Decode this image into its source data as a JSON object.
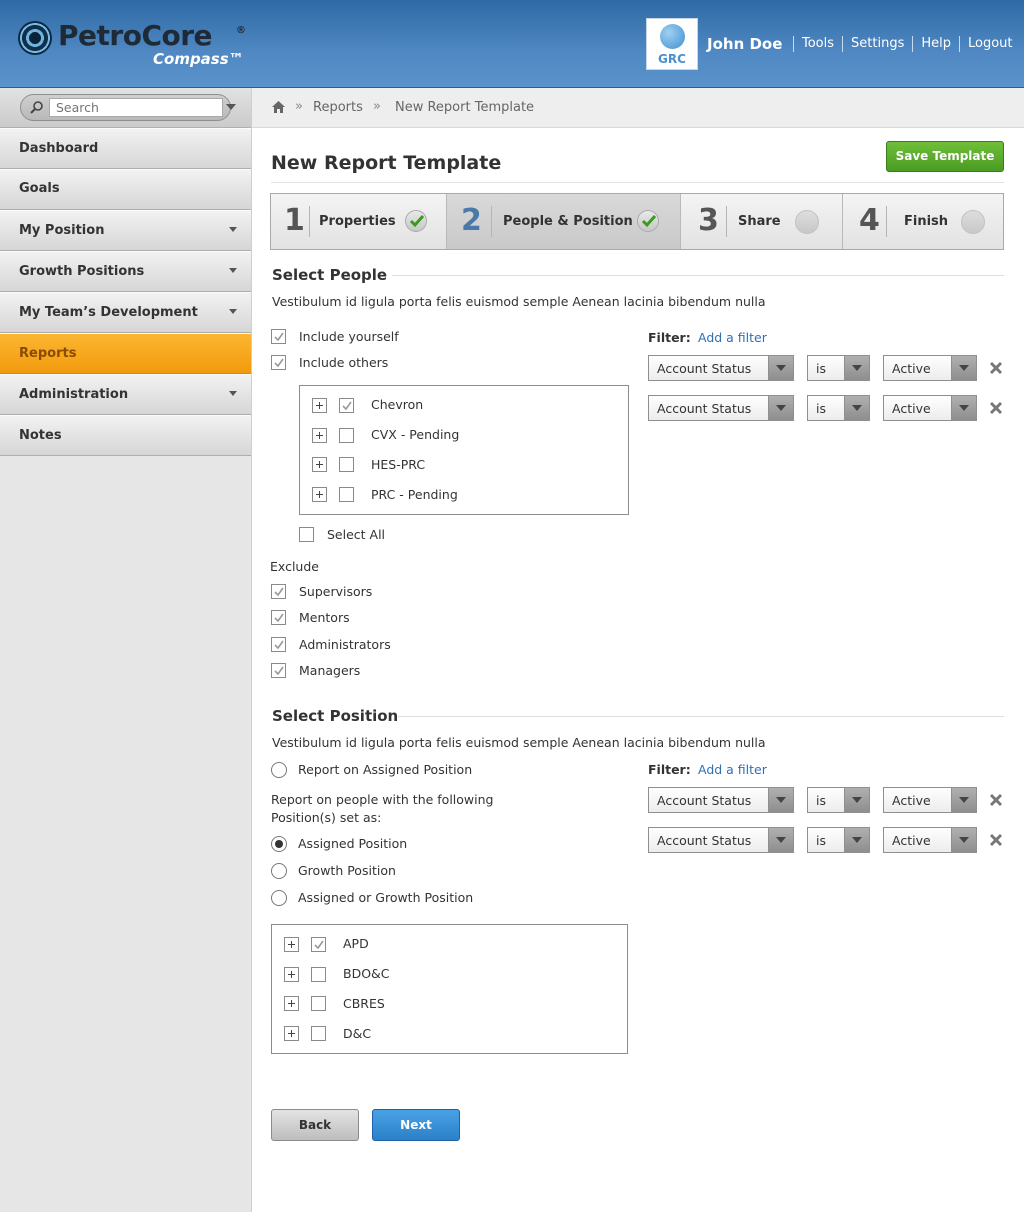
{
  "header": {
    "logo_name": "PetroCore",
    "logo_reg": "®",
    "logo_sub": "Compass™",
    "grc_badge": "GRC",
    "user_name": "John Doe",
    "links": [
      "Tools",
      "Settings",
      "Help",
      "Logout"
    ]
  },
  "sidebar": {
    "search_placeholder": "Search",
    "items": [
      {
        "label": "Dashboard",
        "has_arrow": false,
        "active": false
      },
      {
        "label": "Goals",
        "has_arrow": false,
        "active": false
      },
      {
        "label": "My Position",
        "has_arrow": true,
        "active": false
      },
      {
        "label": "Growth Positions",
        "has_arrow": true,
        "active": false
      },
      {
        "label": "My Team’s Development",
        "has_arrow": true,
        "active": false
      },
      {
        "label": "Reports",
        "has_arrow": false,
        "active": true
      },
      {
        "label": "Administration",
        "has_arrow": true,
        "active": false
      },
      {
        "label": "Notes",
        "has_arrow": false,
        "active": false
      }
    ]
  },
  "breadcrumb": {
    "items": [
      "Reports",
      "New Report Template"
    ],
    "separator": "»"
  },
  "page": {
    "title": "New Report Template",
    "save_label": "Save Template"
  },
  "steps": [
    {
      "num": "1",
      "label": "Properties",
      "status": "complete"
    },
    {
      "num": "2",
      "label": "People & Position",
      "status": "complete"
    },
    {
      "num": "3",
      "label": "Share",
      "status": "pending"
    },
    {
      "num": "4",
      "label": "Finish",
      "status": "pending"
    }
  ],
  "select_people": {
    "title": "Select People",
    "description": "Vestibulum id ligula porta felis euismod semple Aenean lacinia bibendum nulla",
    "include_yourself": {
      "label": "Include yourself",
      "checked": true
    },
    "include_others": {
      "label": "Include others",
      "checked": true
    },
    "tree": [
      {
        "label": "Chevron",
        "checked": true
      },
      {
        "label": "CVX - Pending",
        "checked": false
      },
      {
        "label": "HES-PRC",
        "checked": false
      },
      {
        "label": "PRC - Pending",
        "checked": false
      }
    ],
    "select_all": {
      "label": "Select All",
      "checked": false
    },
    "exclude_label": "Exclude",
    "exclude": [
      {
        "label": "Supervisors",
        "checked": true
      },
      {
        "label": "Mentors",
        "checked": true
      },
      {
        "label": "Administrators",
        "checked": true
      },
      {
        "label": "Managers",
        "checked": true
      }
    ],
    "filter_label": "Filter:",
    "add_filter": "Add a filter",
    "filters": [
      {
        "field": "Account Status",
        "op": "is",
        "value": "Active"
      },
      {
        "field": "Account Status",
        "op": "is",
        "value": "Active"
      }
    ]
  },
  "select_position": {
    "title": "Select Position",
    "description": "Vestibulum id ligula porta felis euismod semple Aenean lacinia bibendum nulla",
    "report_assigned": {
      "label": "Report on Assigned Position",
      "selected": false
    },
    "people_text_1": "Report on people with the following",
    "people_text_2": "Position(s) set as:",
    "options": [
      {
        "label": "Assigned Position",
        "selected": true
      },
      {
        "label": "Growth Position",
        "selected": false
      },
      {
        "label": "Assigned or Growth Position",
        "selected": false
      }
    ],
    "tree": [
      {
        "label": "APD",
        "checked": true
      },
      {
        "label": "BDO&C",
        "checked": false
      },
      {
        "label": "CBRES",
        "checked": false
      },
      {
        "label": "D&C",
        "checked": false
      }
    ],
    "filter_label": "Filter:",
    "add_filter": "Add a filter",
    "filters": [
      {
        "field": "Account Status",
        "op": "is",
        "value": "Active"
      },
      {
        "field": "Account Status",
        "op": "is",
        "value": "Active"
      }
    ]
  },
  "footer": {
    "back_label": "Back",
    "next_label": "Next"
  },
  "colors": {
    "header_blue": "#4f88c2",
    "active_nav": "#f7a820",
    "save_green": "#5aad2c",
    "next_blue": "#3590d8",
    "link_blue": "#2f6fb3"
  }
}
